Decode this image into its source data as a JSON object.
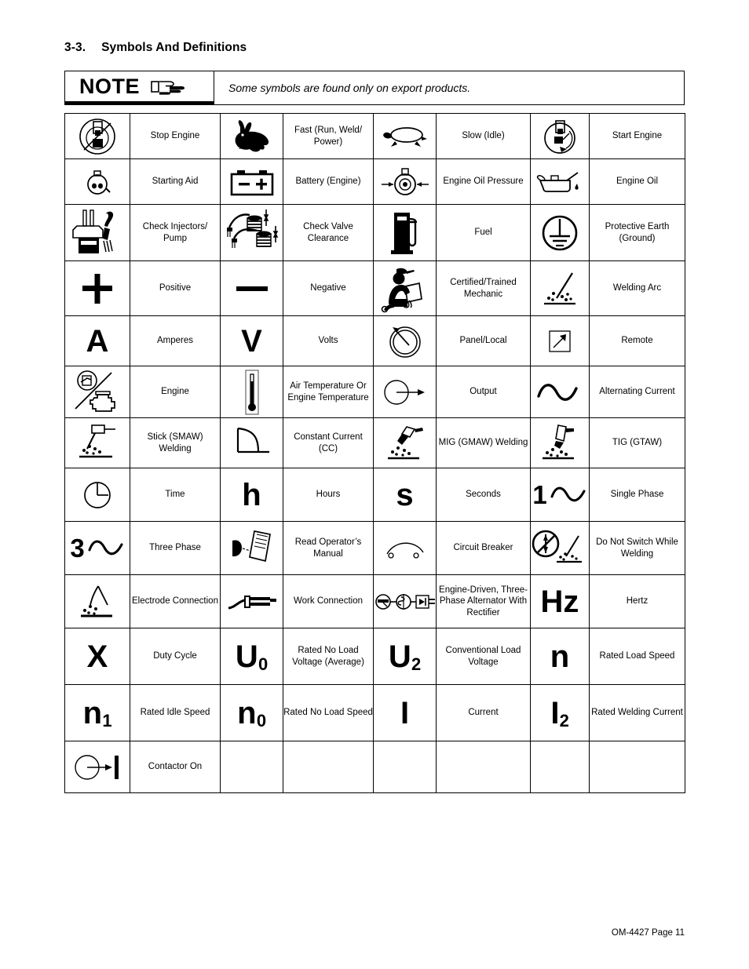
{
  "document": {
    "section_number": "3-3.",
    "section_title": "Symbols And Definitions",
    "footer": "OM-4427 Page 11"
  },
  "note": {
    "label": "NOTE",
    "icon": "pointing-hand-icon",
    "text": "Some symbols are found only on export products."
  },
  "table": {
    "rows": [
      [
        {
          "icon": "stop-engine-icon",
          "label": "Stop Engine"
        },
        {
          "icon": "rabbit-fast-icon",
          "label": "Fast (Run, Weld/ Power)"
        },
        {
          "icon": "turtle-slow-icon",
          "label": "Slow (Idle)"
        },
        {
          "icon": "start-engine-icon",
          "label": "Start Engine"
        }
      ],
      [
        {
          "icon": "starting-aid-icon",
          "label": "Starting Aid"
        },
        {
          "icon": "battery-icon",
          "label": "Battery (Engine)"
        },
        {
          "icon": "engine-oil-pressure-icon",
          "label": "Engine Oil Pressure"
        },
        {
          "icon": "engine-oil-can-icon",
          "label": "Engine Oil"
        }
      ],
      [
        {
          "icon": "check-injectors-pump-icon",
          "label": "Check Injectors/ Pump"
        },
        {
          "icon": "check-valve-clearance-icon",
          "label": "Check Valve Clearance"
        },
        {
          "icon": "fuel-pump-icon",
          "label": "Fuel"
        },
        {
          "icon": "protective-earth-ground-icon",
          "label": "Protective Earth (Ground)"
        }
      ],
      [
        {
          "icon": "plus-positive-icon",
          "label": "Positive"
        },
        {
          "icon": "minus-negative-icon",
          "label": "Negative"
        },
        {
          "icon": "certified-mechanic-icon",
          "label": "Certified/Trained Mechanic"
        },
        {
          "icon": "welding-arc-icon",
          "label": "Welding Arc"
        }
      ],
      [
        {
          "icon": "letter-a-icon",
          "glyph": "A",
          "label": "Amperes"
        },
        {
          "icon": "letter-v-icon",
          "glyph": "V",
          "label": "Volts"
        },
        {
          "icon": "panel-local-dial-icon",
          "label": "Panel/Local"
        },
        {
          "icon": "remote-arrow-icon",
          "label": "Remote"
        }
      ],
      [
        {
          "icon": "engine-icon",
          "label": "Engine"
        },
        {
          "icon": "thermometer-icon",
          "label": "Air Temperature Or Engine Temperature"
        },
        {
          "icon": "output-icon",
          "label": "Output"
        },
        {
          "icon": "alternating-current-icon",
          "label": "Alternating Current"
        }
      ],
      [
        {
          "icon": "stick-smaw-welding-icon",
          "label": "Stick (SMAW) Welding"
        },
        {
          "icon": "constant-current-icon",
          "label": "Constant Current (CC)"
        },
        {
          "icon": "mig-gmaw-welding-icon",
          "label": "MIG (GMAW) Welding"
        },
        {
          "icon": "tig-gtaw-welding-icon",
          "label": "TIG (GTAW)"
        }
      ],
      [
        {
          "icon": "clock-time-icon",
          "label": "Time"
        },
        {
          "icon": "letter-h-icon",
          "glyph": "h",
          "label": "Hours"
        },
        {
          "icon": "letter-s-icon",
          "glyph": "s",
          "label": "Seconds"
        },
        {
          "icon": "single-phase-icon",
          "glyph": "1",
          "label": "Single Phase"
        }
      ],
      [
        {
          "icon": "three-phase-icon",
          "glyph": "3",
          "label": "Three Phase"
        },
        {
          "icon": "read-operators-manual-icon",
          "label": "Read Operator’s Manual"
        },
        {
          "icon": "circuit-breaker-icon",
          "label": "Circuit Breaker"
        },
        {
          "icon": "do-not-switch-while-welding-icon",
          "label": "Do Not Switch While Welding"
        }
      ],
      [
        {
          "icon": "electrode-connection-icon",
          "label": "Electrode Connection"
        },
        {
          "icon": "work-connection-icon",
          "label": "Work Connection"
        },
        {
          "icon": "engine-driven-alternator-rectifier-icon",
          "label": "Engine-Driven, Three-Phase Alternator With Rectifier"
        },
        {
          "icon": "hertz-icon",
          "glyph": "Hz",
          "label": "Hertz"
        }
      ],
      [
        {
          "icon": "letter-x-icon",
          "glyph": "X",
          "label": "Duty Cycle"
        },
        {
          "icon": "u-zero-icon",
          "glyph": "U",
          "sub": "0",
          "label": "Rated No Load Voltage (Average)"
        },
        {
          "icon": "u-two-icon",
          "glyph": "U",
          "sub": "2",
          "label": "Conventional Load Voltage"
        },
        {
          "icon": "letter-n-icon",
          "glyph": "n",
          "label": "Rated Load Speed"
        }
      ],
      [
        {
          "icon": "n-one-icon",
          "glyph": "n",
          "sub": "1",
          "label": "Rated Idle Speed"
        },
        {
          "icon": "n-zero-icon",
          "glyph": "n",
          "sub": "0",
          "label": "Rated No Load Speed"
        },
        {
          "icon": "letter-i-icon",
          "glyph": "I",
          "label": "Current"
        },
        {
          "icon": "i-two-icon",
          "glyph": "I",
          "sub": "2",
          "label": "Rated Welding Current"
        }
      ],
      [
        {
          "icon": "contactor-on-icon",
          "label": "Contactor On"
        },
        {
          "icon": "",
          "label": ""
        },
        {
          "icon": "",
          "label": ""
        },
        {
          "icon": "",
          "label": ""
        }
      ]
    ]
  }
}
